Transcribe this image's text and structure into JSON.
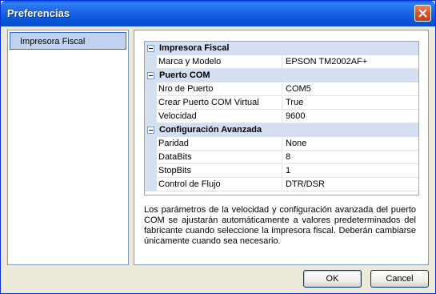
{
  "window": {
    "title": "Preferencias"
  },
  "sidebar": {
    "items": [
      {
        "label": "Impresora Fiscal"
      }
    ]
  },
  "grid": {
    "categories": [
      {
        "title": "Impresora Fiscal",
        "properties": [
          {
            "name": "Marca y Modelo",
            "value": "EPSON TM2002AF+"
          }
        ]
      },
      {
        "title": "Puerto COM",
        "properties": [
          {
            "name": "Nro de Puerto",
            "value": "COM5"
          },
          {
            "name": "Crear Puerto COM Virtual",
            "value": "True"
          },
          {
            "name": "Velocidad",
            "value": "9600"
          }
        ]
      },
      {
        "title": "Configuración Avanzada",
        "properties": [
          {
            "name": "Paridad",
            "value": "None"
          },
          {
            "name": "DataBits",
            "value": "8"
          },
          {
            "name": "StopBits",
            "value": "1"
          },
          {
            "name": "Control de Flujo",
            "value": "DTR/DSR"
          }
        ]
      }
    ]
  },
  "description": "Los parámetros de la velocidad y configuración avanzada del puerto COM se ajustarán automáticamente a valores predeterminados del fabricante cuando seleccione la impresora fiscal. Deberán cambiarse únicamente cuando sea necesario.",
  "buttons": {
    "ok": "OK",
    "cancel": "Cancel"
  },
  "icons": {
    "close": "close-icon",
    "collapse": "collapse-icon"
  },
  "colors": {
    "titlebar": "#0a5de3",
    "selection": "#c1d2ee",
    "category_band": "#d4dff2"
  }
}
